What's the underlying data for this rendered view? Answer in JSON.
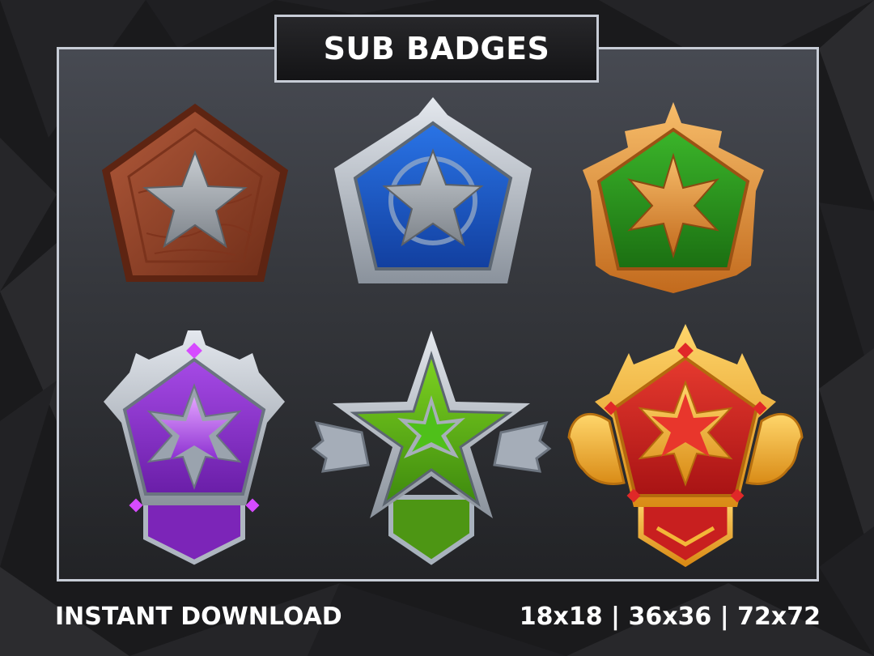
{
  "header": {
    "title": "SUB BADGES"
  },
  "footer": {
    "left_text": "INSTANT DOWNLOAD",
    "right_text": "18x18 | 36x36 | 72x72"
  },
  "badges": [
    {
      "tier": "wood",
      "frame_color": "#8b3f25",
      "fill_color": "#9d4a2b",
      "star_color": "#9ea3a8"
    },
    {
      "tier": "blue",
      "frame_color": "#aeb6c0",
      "fill_color": "#1d5fd0",
      "star_color": "#a9b0b8"
    },
    {
      "tier": "green-bronze",
      "frame_color": "#e39a3d",
      "fill_color": "#2f9a1e",
      "star_color": "#e7934a"
    },
    {
      "tier": "purple",
      "frame_color": "#b9c3d0",
      "fill_color": "#8e2fd0",
      "star_color": "#b65bf0"
    },
    {
      "tier": "lime",
      "frame_color": "#a8b2bd",
      "fill_color": "#5aaa18",
      "star_color": "#62c51d"
    },
    {
      "tier": "red-gold",
      "frame_color": "#f2b33a",
      "fill_color": "#d42a27",
      "star_color": "#e8362c"
    }
  ],
  "colors": {
    "background": "#1b1b1d",
    "panel_border": "#c7ccd6",
    "text": "#ffffff"
  }
}
